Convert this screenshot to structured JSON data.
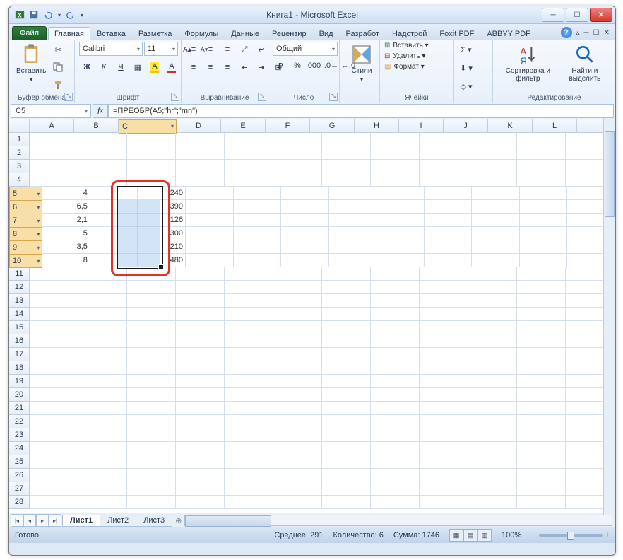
{
  "title": "Книга1  -  Microsoft Excel",
  "qat": {
    "save": "save-icon",
    "undo": "undo-icon",
    "redo": "redo-icon"
  },
  "tabs": {
    "file": "Файл",
    "items": [
      "Главная",
      "Вставка",
      "Разметка",
      "Формулы",
      "Данные",
      "Рецензир",
      "Вид",
      "Разработ",
      "Надстрой",
      "Foxit PDF",
      "ABBYY PDF"
    ],
    "active": 0
  },
  "ribbon": {
    "clipboard": {
      "label": "Буфер обмена",
      "paste": "Вставить"
    },
    "font": {
      "label": "Шрифт",
      "name": "Calibri",
      "size": "11",
      "bold": "Ж",
      "italic": "К",
      "underline": "Ч"
    },
    "align": {
      "label": "Выравнивание"
    },
    "number": {
      "label": "Число",
      "format": "Общий"
    },
    "styles": {
      "label": "",
      "btn": "Стили"
    },
    "cells": {
      "label": "Ячейки",
      "insert": "Вставить ▾",
      "delete": "Удалить ▾",
      "format": "Формат ▾"
    },
    "editing": {
      "label": "Редактирование",
      "sort": "Сортировка и фильтр",
      "find": "Найти и выделить"
    }
  },
  "namebox": "C5",
  "formula": "=ПРЕОБР(A5;\"hr\";\"mn\")",
  "columns": [
    "A",
    "B",
    "C",
    "D",
    "E",
    "F",
    "G",
    "H",
    "I",
    "J",
    "K",
    "L"
  ],
  "rowcount": 28,
  "dataA": {
    "5": "4",
    "6": "6,5",
    "7": "2,1",
    "8": "5",
    "9": "3,5",
    "10": "8"
  },
  "dataC": {
    "5": "240",
    "6": "390",
    "7": "126",
    "8": "300",
    "9": "210",
    "10": "480"
  },
  "sheets": {
    "items": [
      "Лист1",
      "Лист2",
      "Лист3"
    ],
    "active": 0
  },
  "status": {
    "ready": "Готово",
    "avg": "Среднее: 291",
    "count": "Количество: 6",
    "sum": "Сумма: 1746",
    "zoom": "100%"
  }
}
